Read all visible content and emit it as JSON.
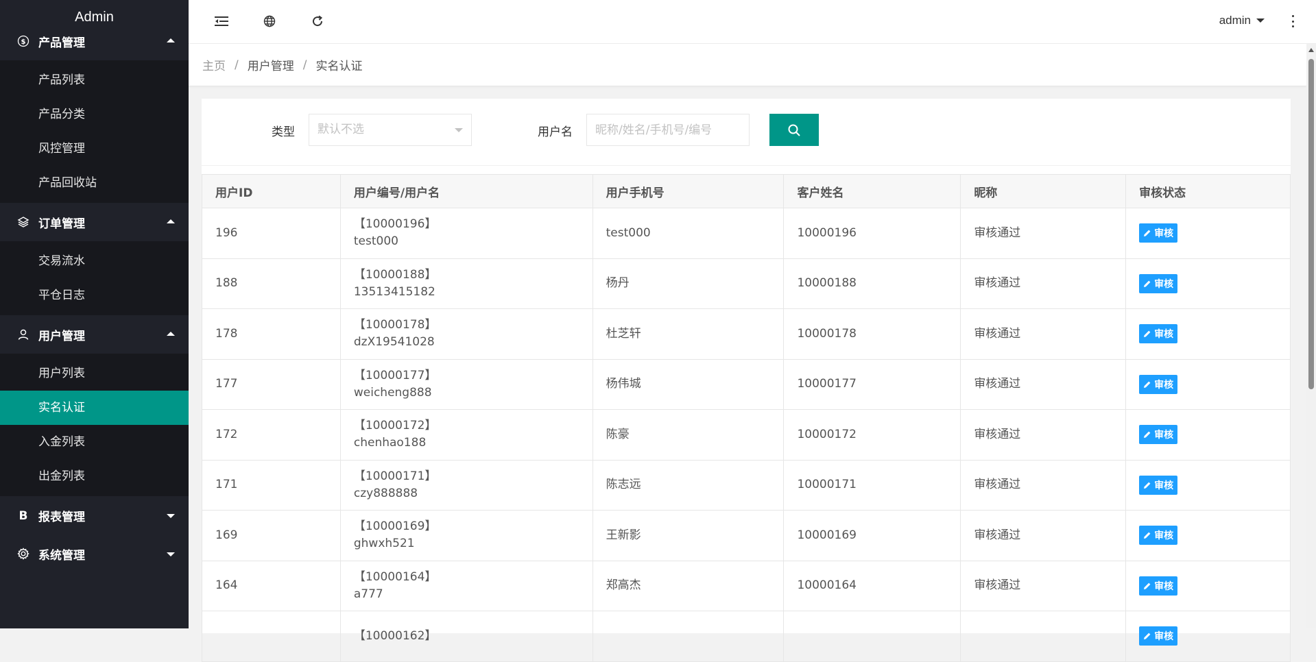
{
  "app": {
    "title": "Admin"
  },
  "sidebar": {
    "groups": [
      {
        "label": "产品管理",
        "icon": "dollar-circle-icon",
        "expanded": true,
        "items": [
          {
            "label": "产品列表"
          },
          {
            "label": "产品分类"
          },
          {
            "label": "风控管理"
          },
          {
            "label": "产品回收站"
          }
        ]
      },
      {
        "label": "订单管理",
        "icon": "layers-icon",
        "expanded": true,
        "items": [
          {
            "label": "交易流水"
          },
          {
            "label": "平仓日志"
          }
        ]
      },
      {
        "label": "用户管理",
        "icon": "user-icon",
        "expanded": true,
        "items": [
          {
            "label": "用户列表"
          },
          {
            "label": "实名认证",
            "active": true
          },
          {
            "label": "入金列表"
          },
          {
            "label": "出金列表"
          }
        ]
      },
      {
        "label": "报表管理",
        "icon": "letter-b-icon",
        "expanded": false,
        "items": []
      },
      {
        "label": "系统管理",
        "icon": "gear-icon",
        "expanded": false,
        "items": []
      }
    ]
  },
  "header": {
    "icons": [
      "menu-collapse-icon",
      "globe-icon",
      "refresh-icon"
    ],
    "user": "admin"
  },
  "breadcrumb": [
    "主页",
    "用户管理",
    "实名认证"
  ],
  "filter": {
    "type_label": "类型",
    "type_placeholder": "默认不选",
    "username_label": "用户名",
    "username_placeholder": "昵称/姓名/手机号/编号"
  },
  "table": {
    "columns": [
      "用户ID",
      "用户编号/用户名",
      "用户手机号",
      "客户姓名",
      "昵称",
      "审核状态"
    ],
    "action_label": "审核",
    "rows": [
      {
        "id": "196",
        "code": "【10000196】",
        "username": "test000",
        "phone": "test000",
        "name": "10000196",
        "nickname": "审核通过"
      },
      {
        "id": "188",
        "code": "【10000188】",
        "username": "13513415182",
        "phone": "杨丹",
        "name": "10000188",
        "nickname": "审核通过"
      },
      {
        "id": "178",
        "code": "【10000178】",
        "username": "dzX19541028",
        "phone": "杜芝轩",
        "name": "10000178",
        "nickname": "审核通过"
      },
      {
        "id": "177",
        "code": "【10000177】",
        "username": "weicheng888",
        "phone": "杨伟城",
        "name": "10000177",
        "nickname": "审核通过"
      },
      {
        "id": "172",
        "code": "【10000172】",
        "username": "chenhao188",
        "phone": "陈豪",
        "name": "10000172",
        "nickname": "审核通过"
      },
      {
        "id": "171",
        "code": "【10000171】",
        "username": "czy888888",
        "phone": "陈志远",
        "name": "10000171",
        "nickname": "审核通过"
      },
      {
        "id": "169",
        "code": "【10000169】",
        "username": "ghwxh521",
        "phone": "王新影",
        "name": "10000169",
        "nickname": "审核通过"
      },
      {
        "id": "164",
        "code": "【10000164】",
        "username": "a777",
        "phone": "郑高杰",
        "name": "10000164",
        "nickname": "审核通过"
      },
      {
        "id": "",
        "code": "【10000162】",
        "username": "",
        "phone": "",
        "name": "",
        "nickname": ""
      }
    ]
  },
  "colors": {
    "primary": "#009688",
    "action": "#1e9fff",
    "sidebar_bg": "#20222a",
    "sidebar_sub_bg": "#17181d"
  }
}
